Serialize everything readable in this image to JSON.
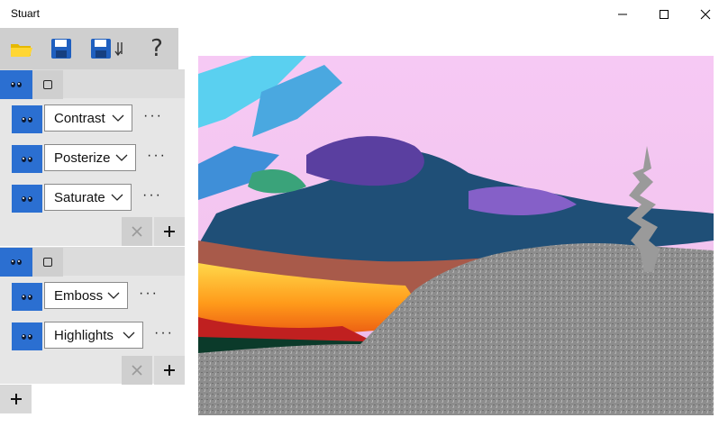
{
  "window": {
    "title": "Stuart",
    "minimize_icon": "minimize-icon",
    "maximize_icon": "maximize-icon",
    "close_icon": "close-icon"
  },
  "toolbar": {
    "open_icon": "folder-open-icon",
    "save_icon": "save-icon",
    "save_as_icon": "save-as-icon",
    "help_icon": "help-icon",
    "help_glyph": "?"
  },
  "groups": [
    {
      "effects": [
        {
          "label": "Contrast",
          "more": "···"
        },
        {
          "label": "Posterize",
          "more": "···"
        },
        {
          "label": "Saturate",
          "more": "···"
        }
      ]
    },
    {
      "effects": [
        {
          "label": "Emboss",
          "more": "···"
        },
        {
          "label": "Highlights",
          "more": "···"
        }
      ]
    }
  ],
  "colors": {
    "accent": "#2b6fd1",
    "panel": "#e6e6e6",
    "button_gray": "#cfcfcf"
  }
}
